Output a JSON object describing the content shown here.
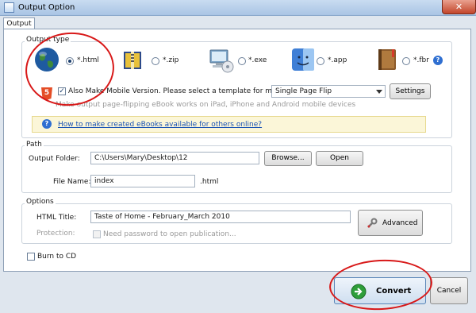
{
  "window": {
    "title": "Output Option",
    "close_glyph": "✕"
  },
  "tabs": [
    {
      "label": "Output"
    }
  ],
  "output_type": {
    "label": "Output type",
    "options": [
      {
        "label": "*.html",
        "icon": "globe-icon",
        "selected": true
      },
      {
        "label": "*.zip",
        "icon": "zip-archive-icon",
        "selected": false
      },
      {
        "label": "*.exe",
        "icon": "computer-disc-icon",
        "selected": false
      },
      {
        "label": "*.app",
        "icon": "mac-finder-icon",
        "selected": false
      },
      {
        "label": "*.fbr",
        "icon": "book-icon",
        "selected": false
      }
    ],
    "help_glyph": "?",
    "mobile_checkbox_label": "Also Make Mobile Version. Please select a template for mobile:",
    "mobile_checked": true,
    "mobile_template": "Single Page Flip",
    "settings_label": "Settings",
    "mobile_note": "Make output page-flipping eBook works on iPad, iPhone and Android mobile devices",
    "html5_badge": "5",
    "info_link": "How to make created eBooks available for others online?"
  },
  "path": {
    "label": "Path",
    "output_folder_label": "Output Folder:",
    "output_folder_value": "C:\\Users\\Mary\\Desktop\\12",
    "browse_label": "Browse...",
    "open_label": "Open",
    "file_name_label": "File Name:",
    "file_name_value": "index",
    "file_ext": ".html"
  },
  "options": {
    "label": "Options",
    "html_title_label": "HTML Title:",
    "html_title_value": "Taste of Home - February_March 2010",
    "protection_label": "Protection:",
    "protection_checkbox_label": "Need password to open publication...",
    "advanced_label": "Advanced"
  },
  "burn_to_cd_label": "Burn to CD",
  "footer": {
    "convert_label": "Convert",
    "cancel_label": "Cancel"
  },
  "colors": {
    "annotation_red": "#d81818",
    "link_blue": "#1a53b5"
  }
}
